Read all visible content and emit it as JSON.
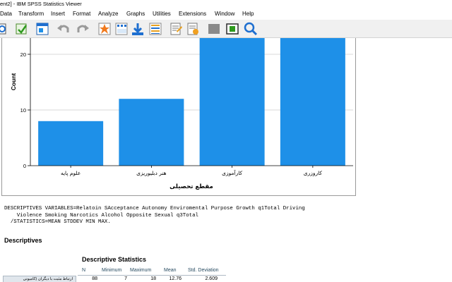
{
  "window": {
    "title": "ent2] - IBM SPSS Statistics Viewer"
  },
  "menu": [
    {
      "name": "menu-data",
      "label": "Data"
    },
    {
      "name": "menu-transform",
      "label": "Transform"
    },
    {
      "name": "menu-insert",
      "label": "Insert"
    },
    {
      "name": "menu-format",
      "label": "Format"
    },
    {
      "name": "menu-analyze",
      "label": "Analyze"
    },
    {
      "name": "menu-graphs",
      "label": "Graphs"
    },
    {
      "name": "menu-utilities",
      "label": "Utilities"
    },
    {
      "name": "menu-extensions",
      "label": "Extensions"
    },
    {
      "name": "menu-window",
      "label": "Window"
    },
    {
      "name": "menu-help",
      "label": "Help"
    }
  ],
  "toolbar": {
    "icons": [
      "print-preview-icon",
      "export-icon",
      "recall-dialog-icon",
      "undo-icon",
      "redo-icon",
      "goto-case-icon",
      "goto-variable-icon",
      "variables-icon",
      "select-cases-icon",
      "insert-text-icon",
      "designate-window-icon",
      "show-all-icon",
      "hide-icon",
      "insert-output-icon",
      "search-icon"
    ],
    "accent": "#1e90d6"
  },
  "chart_data": {
    "type": "bar",
    "categories": [
      "علوم پایه",
      "هنر دبلیوریزی",
      "کارآموزی",
      "کاروزری"
    ],
    "values": [
      8,
      12,
      24,
      24
    ],
    "xlabel": "مقطع تحصیلی",
    "ylabel": "Count",
    "yticks": [
      0,
      10,
      20
    ],
    "ylim": [
      0,
      24.8
    ],
    "grid": true,
    "bar_color": "#1e90e8"
  },
  "syntax": {
    "lines": [
      "DESCRIPTIVES VARIABLES=Relatoin SAcceptance Autonomy Enviromental Purpose Growth q1Total Driving",
      "    Violence Smoking Narcotics Alcohol Opposite Sexual q3Total",
      "  /STATISTICS=MEAN STDDEV MIN MAX."
    ]
  },
  "output": {
    "heading": "Descriptives",
    "table_title": "Descriptive Statistics",
    "columns": [
      "N",
      "Minimum",
      "Maximum",
      "Mean",
      "Std. Deviation"
    ],
    "rows": [
      {
        "label": "ارتباط مثبت با دیگران (کامیونی",
        "values": [
          "88",
          "7",
          "18",
          "12.76",
          "2.609"
        ]
      }
    ]
  }
}
